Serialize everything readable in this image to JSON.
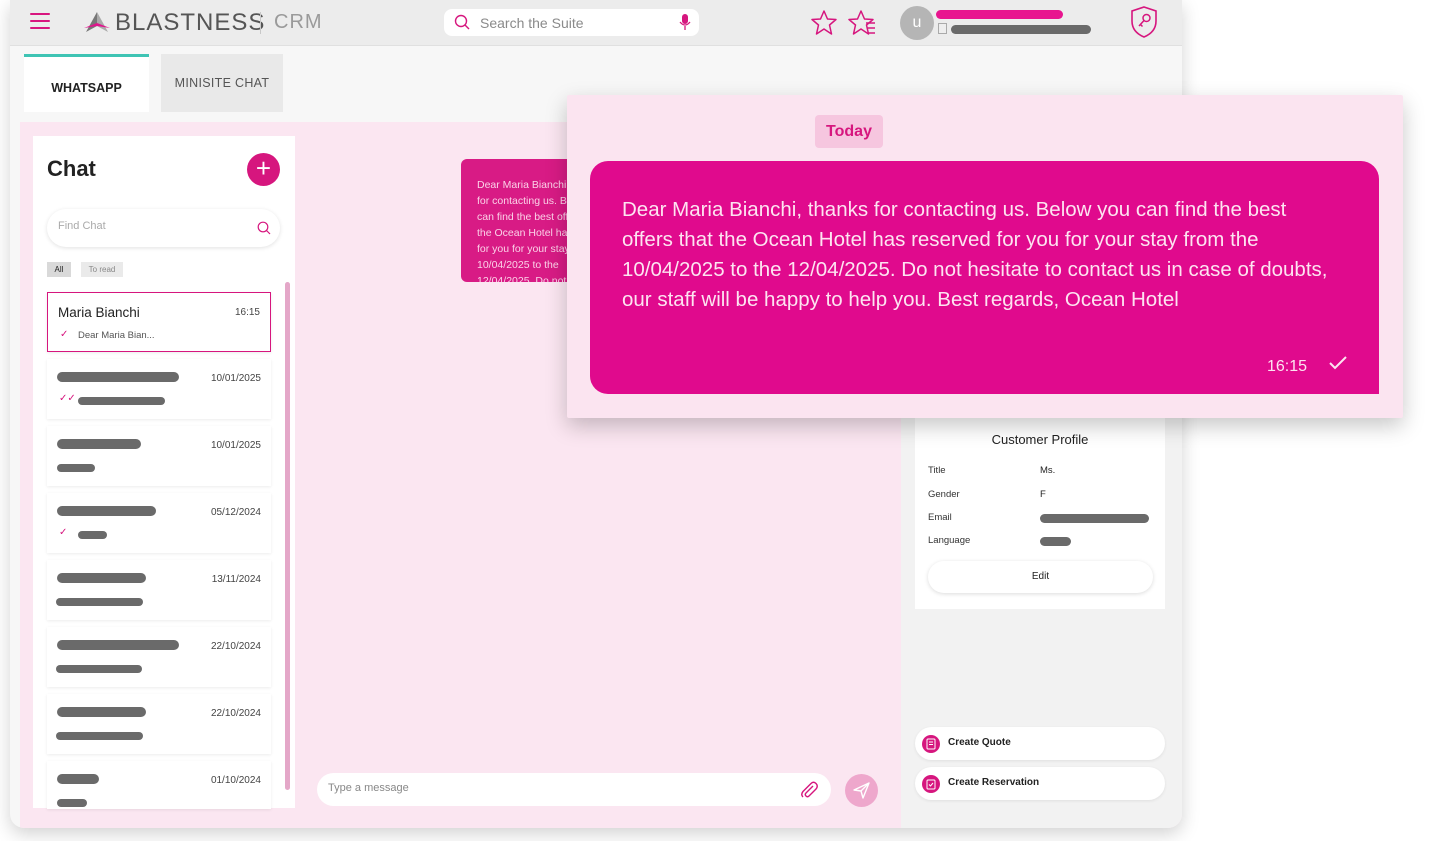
{
  "header": {
    "brand": "BLASTNESS",
    "product": "CRM",
    "search_placeholder": "Search the Suite",
    "avatar_initial": "u"
  },
  "tabs": [
    {
      "label": "WHATSAPP",
      "active": true
    },
    {
      "label": "MINISITE CHAT",
      "active": false
    }
  ],
  "chat_panel": {
    "title": "Chat",
    "find_placeholder": "Find Chat",
    "filters": [
      "All",
      "To read"
    ],
    "active_chat": {
      "name": "Maria Bianchi",
      "time": "16:15",
      "preview": "Dear Maria Bian..."
    },
    "other_dates": [
      "10/01/2025",
      "10/01/2025",
      "05/12/2024",
      "13/11/2024",
      "22/10/2024",
      "22/10/2024",
      "01/10/2024"
    ]
  },
  "conversation": {
    "bubble_preview": "Dear Maria Bianchi, thanks for contacting us. Below you can find the best offers that the Ocean Hotel has reserved for you for your stay from the 10/04/2025 to the 12/04/2025. Do not hesitate to contact us in case of doubts, our staff will be happy to help you. Best regards, Ocean Hotel",
    "composer_placeholder": "Type a message"
  },
  "zoom": {
    "day_label": "Today",
    "message": "Dear Maria Bianchi, thanks for contacting us. Below you can find the best offers that the Ocean Hotel has reserved for you for your stay from the 10/04/2025 to the 12/04/2025. Do not hesitate to contact us in case of doubts, our staff will be happy to help you. Best regards, Ocean Hotel",
    "time": "16:15"
  },
  "profile": {
    "title": "Customer Profile",
    "fields": [
      {
        "label": "Title",
        "value": "Ms."
      },
      {
        "label": "Gender",
        "value": "F"
      },
      {
        "label": "Email",
        "value": ""
      },
      {
        "label": "Language",
        "value": ""
      }
    ],
    "edit_label": "Edit"
  },
  "actions": {
    "create_quote": "Create Quote",
    "create_reservation": "Create Reservation"
  },
  "colors": {
    "accent": "#d6167e",
    "accent_bright": "#e00a8d",
    "tab_indicator": "#3fc4b4",
    "main_bg": "#fbe6f1"
  },
  "icons": [
    "menu-icon",
    "logo-icon",
    "search-icon",
    "mic-icon",
    "star-icon",
    "starred-list-icon",
    "shield-key-icon",
    "plus-icon",
    "check-icon",
    "double-check-icon",
    "paperclip-icon",
    "send-icon",
    "quote-icon",
    "calendar-icon"
  ]
}
